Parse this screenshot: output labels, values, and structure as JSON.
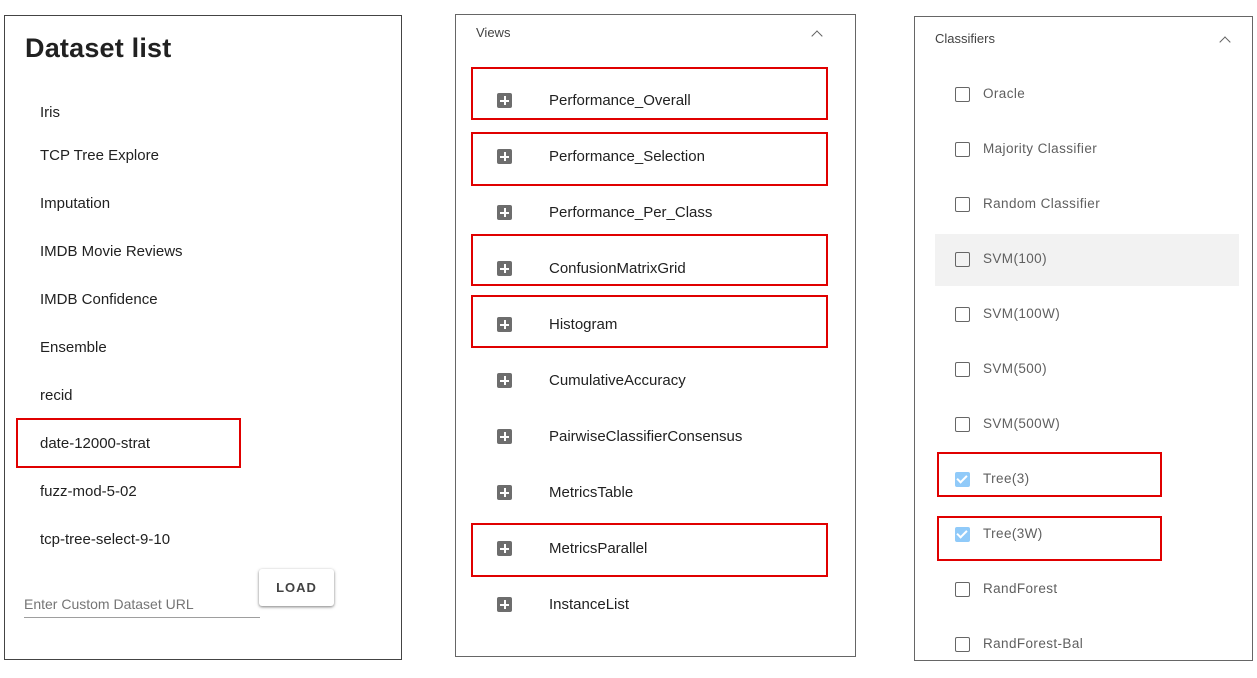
{
  "dataset_panel": {
    "title": "Dataset list",
    "items": [
      "Iris",
      "TCP Tree Explore",
      "Imputation",
      "IMDB Movie Reviews",
      "IMDB Confidence",
      "Ensemble",
      "recid",
      "date-12000-strat",
      "fuzz-mod-5-02",
      "tcp-tree-select-9-10"
    ],
    "custom_url_placeholder": "Enter Custom Dataset URL",
    "load_label": "LOAD"
  },
  "views_panel": {
    "title": "Views",
    "items": [
      "Performance_Overall",
      "Performance_Selection",
      "Performance_Per_Class",
      "ConfusionMatrixGrid",
      "Histogram",
      "CumulativeAccuracy",
      "PairwiseClassifierConsensus",
      "MetricsTable",
      "MetricsParallel",
      "InstanceList"
    ]
  },
  "classifiers_panel": {
    "title": "Classifiers",
    "items": [
      {
        "label": "Oracle",
        "checked": false
      },
      {
        "label": "Majority Classifier",
        "checked": false
      },
      {
        "label": "Random Classifier",
        "checked": false
      },
      {
        "label": "SVM(100)",
        "checked": false
      },
      {
        "label": "SVM(100W)",
        "checked": false
      },
      {
        "label": "SVM(500)",
        "checked": false
      },
      {
        "label": "SVM(500W)",
        "checked": false
      },
      {
        "label": "Tree(3)",
        "checked": true
      },
      {
        "label": "Tree(3W)",
        "checked": true
      },
      {
        "label": "RandForest",
        "checked": false
      },
      {
        "label": "RandForest-Bal",
        "checked": false
      }
    ]
  },
  "colors": {
    "highlight": "#e00000",
    "checkbox_checked": "#90caf9",
    "plus_icon": "#6d6d6d"
  }
}
